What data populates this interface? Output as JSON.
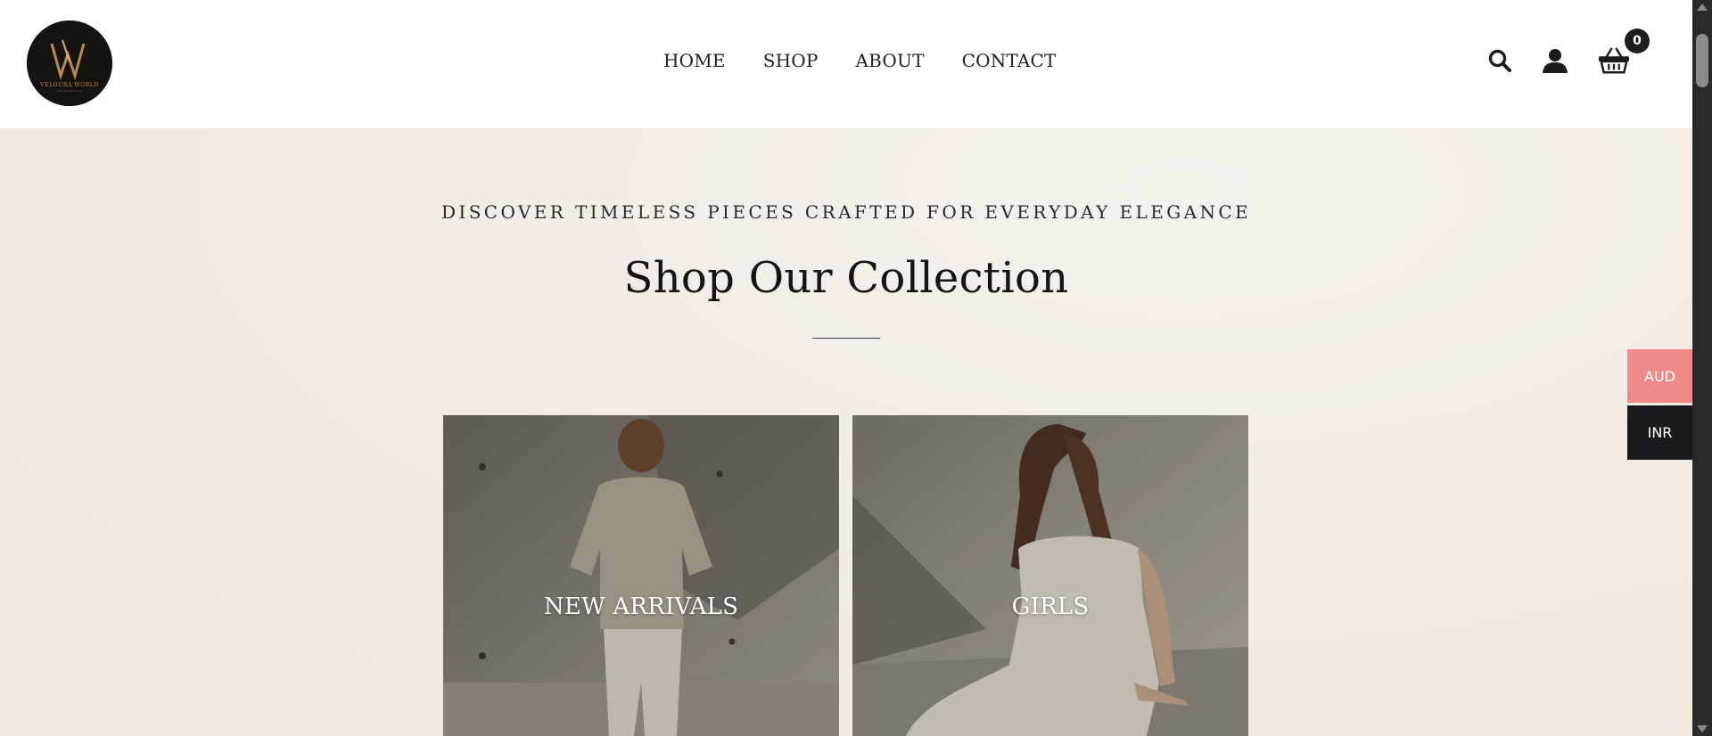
{
  "header": {
    "logo_text": "VELOURA WORLD",
    "nav": [
      {
        "label": "HOME"
      },
      {
        "label": "SHOP"
      },
      {
        "label": "ABOUT"
      },
      {
        "label": "CONTACT"
      }
    ],
    "icons": [
      "search-icon",
      "user-icon",
      "basket-icon"
    ],
    "cart_count": "0"
  },
  "hero": {
    "tagline": "DISCOVER TIMELESS PIECES CRAFTED FOR EVERYDAY ELEGANCE",
    "title": "Shop Our Collection"
  },
  "collections": [
    {
      "label": "NEW ARRIVALS"
    },
    {
      "label": "GIRLS"
    }
  ],
  "currency": {
    "options": [
      "AUD",
      "INR"
    ],
    "colors": {
      "AUD": "#ef8a8a",
      "INR": "#1b1a1e"
    }
  }
}
